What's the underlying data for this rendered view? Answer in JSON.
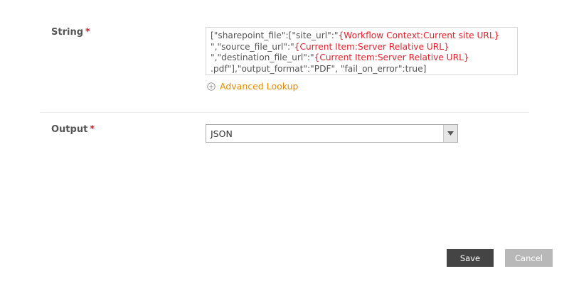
{
  "string_field": {
    "label": "String",
    "required_mark": "*",
    "lines": [
      [
        {
          "text": "[\"sharepoint_file\":[\"site_url\":\"",
          "token": false
        },
        {
          "text": "{Workflow Context:Current site URL}",
          "token": true
        }
      ],
      [
        {
          "text": "\",\"source_file_url\":\"",
          "token": false
        },
        {
          "text": "{Current Item:Server Relative URL}",
          "token": true
        }
      ],
      [
        {
          "text": "\",\"destination_file_url\":\"",
          "token": false
        },
        {
          "text": "{Current Item:Server Relative URL}",
          "token": true
        }
      ],
      [
        {
          "text": ".pdf\"],\"output_format\":\"PDF\", \"fail_on_error\":true]",
          "token": false
        }
      ]
    ],
    "lookup_label": "Advanced Lookup",
    "lookup_icon": "plus-circle-icon"
  },
  "output_field": {
    "label": "Output",
    "required_mark": "*",
    "selected_value": "JSON",
    "arrow_icon": "triangle-down-icon"
  },
  "actions": {
    "save_label": "Save",
    "cancel_label": "Cancel"
  },
  "colors": {
    "token": "#e8202a",
    "link": "#e68a00",
    "required": "#d0202e",
    "save_bg": "#444444",
    "cancel_bg": "#b8b8b8"
  }
}
